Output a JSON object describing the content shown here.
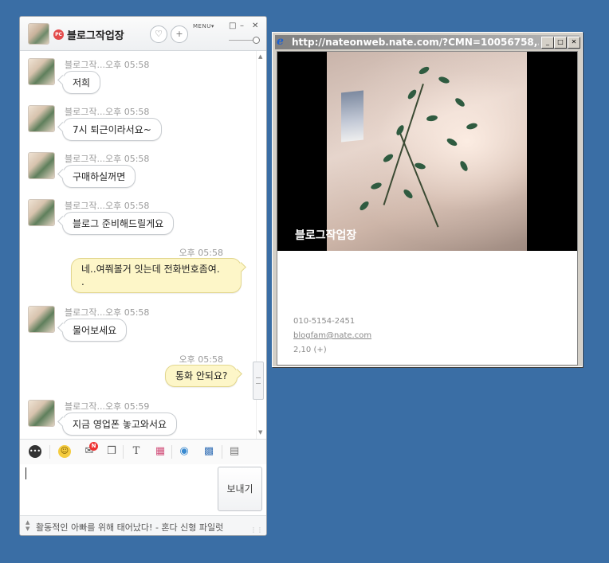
{
  "chat": {
    "title": "블로그작업장",
    "pc_badge": "PC",
    "menu_label": "MENU",
    "messages": [
      {
        "meta": "블로그작...오후 05:58",
        "text": "저희"
      },
      {
        "meta": "블로그작...오후 05:58",
        "text": "7시 퇴근이라서요~"
      },
      {
        "meta": "블로그작...오후 05:58",
        "text": "구매하실꺼면"
      },
      {
        "meta": "블로그작...오후 05:58",
        "text": "블로그 준비해드릴게요"
      },
      {
        "meta": "오후 05:58",
        "text_line1": "네..여쭤볼거 잇는데 전화번호좀여.",
        "text_line2": "."
      },
      {
        "meta": "블로그작...오후 05:58",
        "text": "물어보세요"
      },
      {
        "meta": "오후 05:58",
        "text": "통화 안되요?"
      },
      {
        "meta": "블로그작...오후 05:59",
        "text": "지금 영업폰 놓고와서요"
      }
    ],
    "toolbar": {
      "n_badge": "N",
      "text_tool": "T"
    },
    "send_label": "보내기",
    "status_text": "활동적인 아빠를 위해 태어났다! - 혼다 신형 파일럿"
  },
  "popup": {
    "url": "http://nateonweb.nate.com/?CMN=10056758,...",
    "caption": "블로그작업장",
    "phone": "010-5154-2451",
    "email": "blogfam@nate.com",
    "count": "2,10 (+)"
  }
}
